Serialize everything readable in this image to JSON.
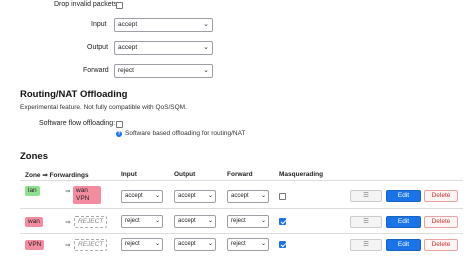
{
  "general": {
    "drop_invalid_label": "Drop invalid packets",
    "drop_invalid_checked": false,
    "input_label": "Input",
    "input_value": "accept",
    "output_label": "Output",
    "output_value": "accept",
    "forward_label": "Forward",
    "forward_value": "reject"
  },
  "offload": {
    "title": "Routing/NAT Offloading",
    "description": "Experimental feature. Not fully compatible with QoS/SQM.",
    "sw_label": "Software flow offloading:",
    "sw_checked": false,
    "hint": "Software based offloading for routing/NAT"
  },
  "zones": {
    "title": "Zones",
    "headers": {
      "zone": "Zone ⇒ Forwardings",
      "input": "Input",
      "output": "Output",
      "forward": "Forward",
      "masq": "Masquerading"
    },
    "rows": [
      {
        "zone": "lan",
        "forwardings": [
          "wan",
          "VPN"
        ],
        "input": "accept",
        "output": "accept",
        "forward": "accept",
        "masq": false
      },
      {
        "zone": "wan",
        "forwardings": [
          "REJECT"
        ],
        "input": "reject",
        "output": "accept",
        "forward": "reject",
        "masq": true
      },
      {
        "zone": "VPN",
        "forwardings": [
          "REJECT"
        ],
        "input": "reject",
        "output": "accept",
        "forward": "reject",
        "masq": true
      }
    ],
    "arrow": "⇒",
    "drag_label": "☰",
    "edit_label": "Edit",
    "delete_label": "Delete"
  },
  "icons": {
    "chevron": "chevron-down-icon",
    "help": "help-icon"
  },
  "colors": {
    "lan": "#90e090",
    "wan": "#f48ca0",
    "edit": "#1a73e8"
  }
}
